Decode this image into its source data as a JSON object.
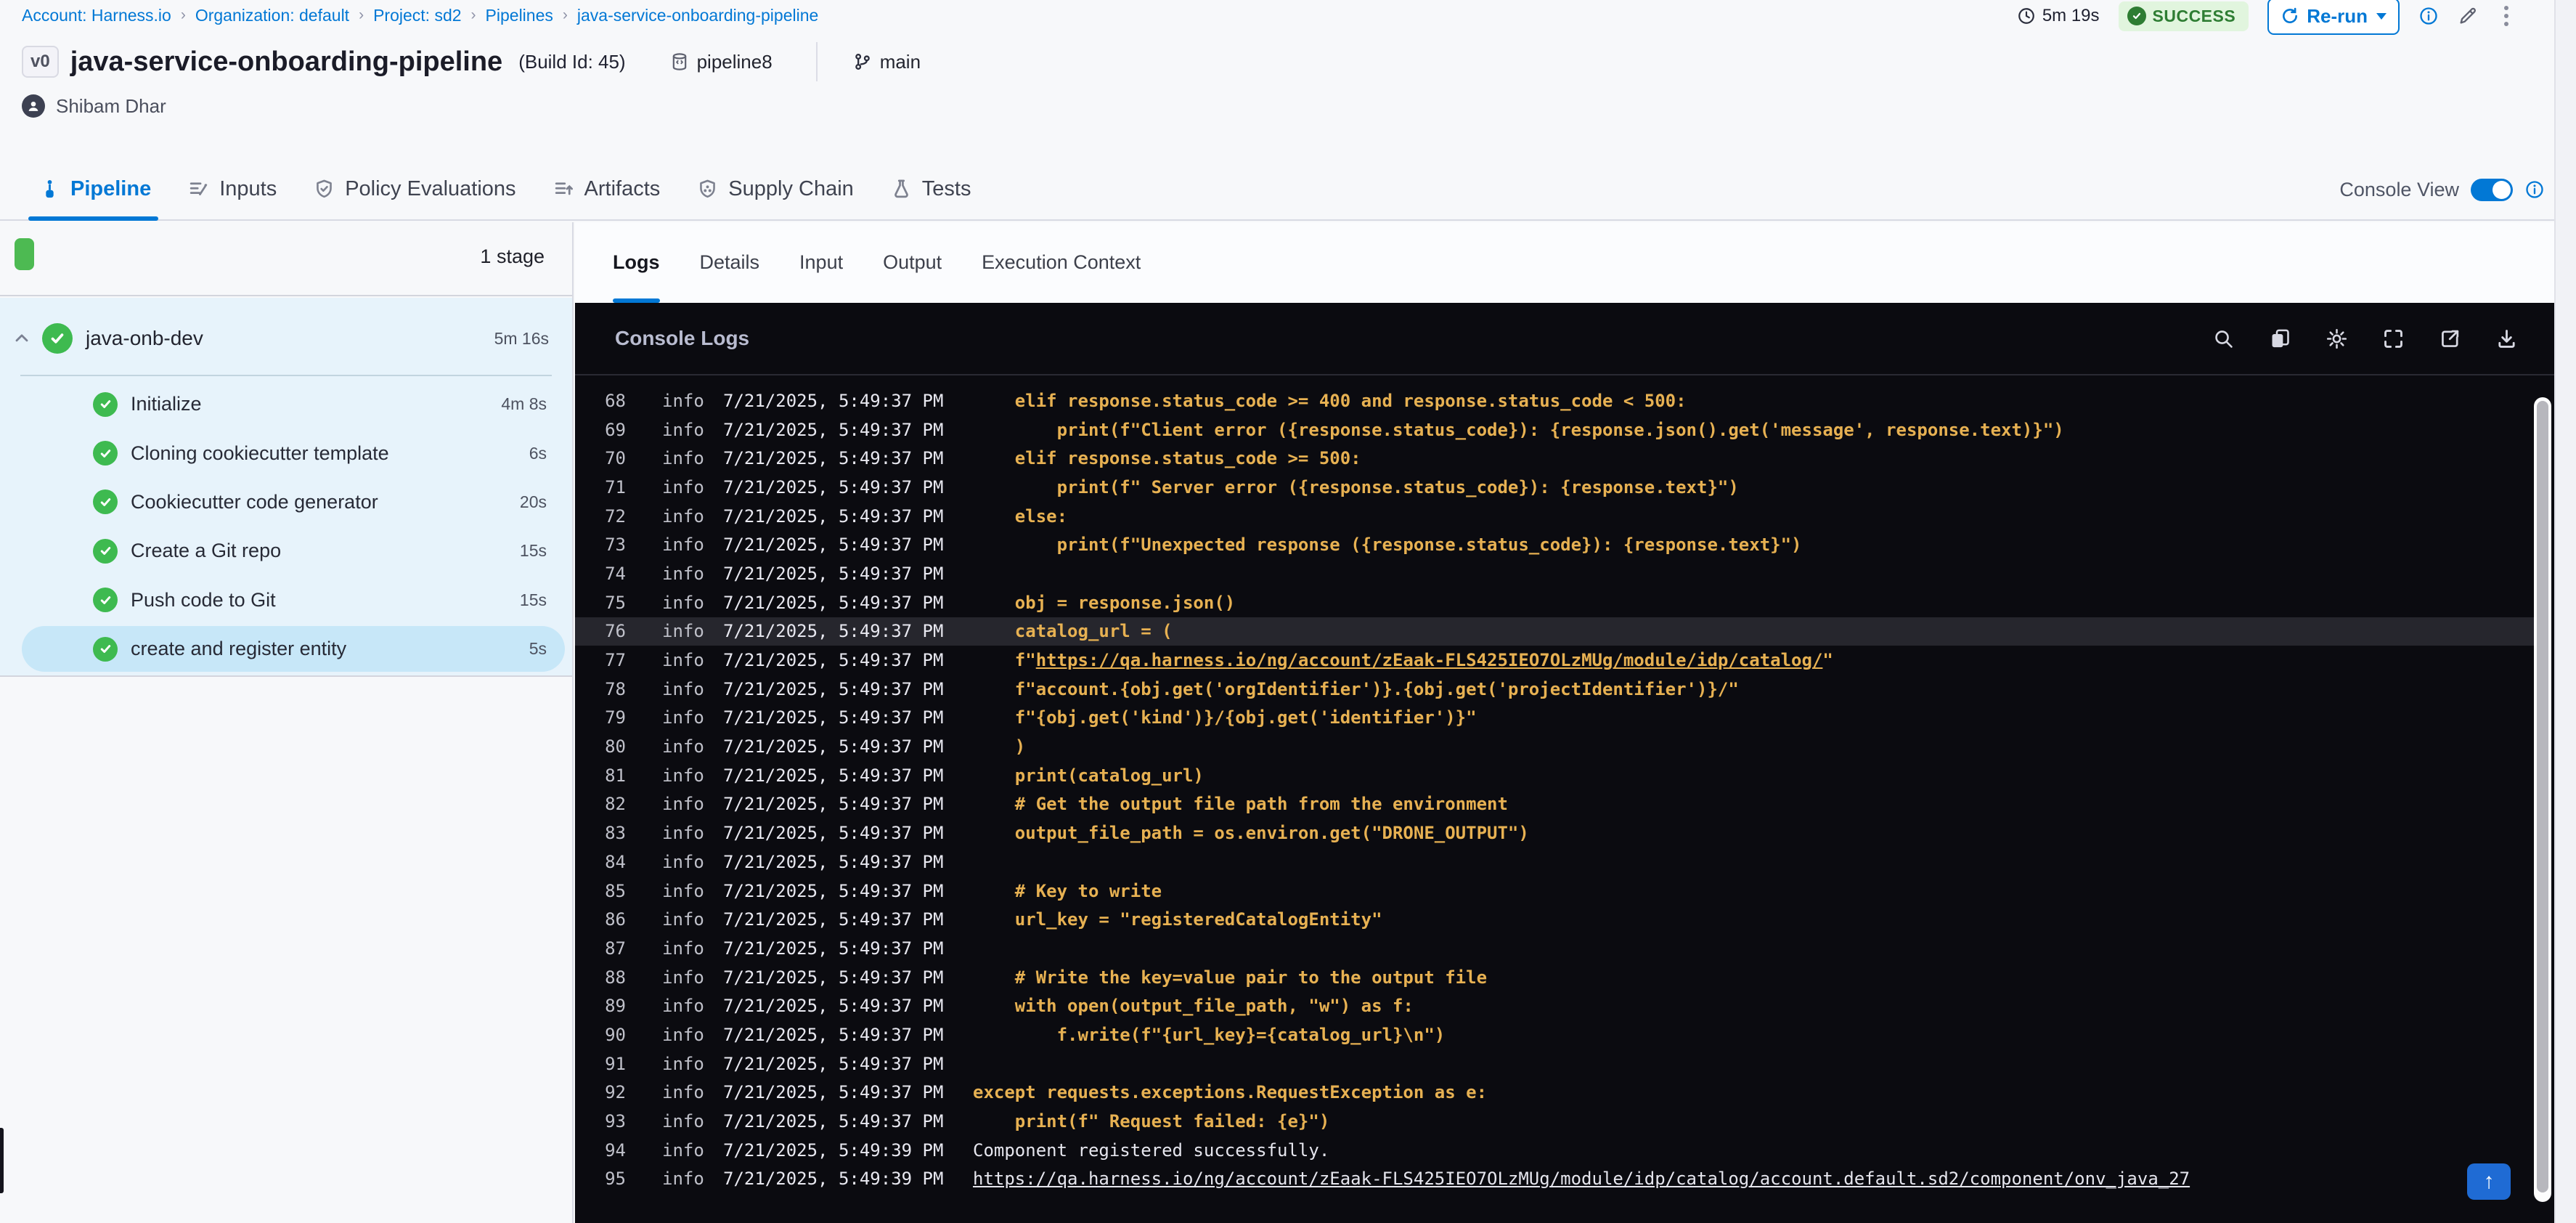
{
  "breadcrumb": {
    "items": [
      {
        "label": "Account: Harness.io"
      },
      {
        "label": "Organization: default"
      },
      {
        "label": "Project: sd2"
      },
      {
        "label": "Pipelines"
      },
      {
        "label": "java-service-onboarding-pipeline"
      }
    ]
  },
  "topbar": {
    "duration": "5m 19s",
    "status": "SUCCESS",
    "rerun_label": "Re-run"
  },
  "header": {
    "version_badge": "v0",
    "title": "java-service-onboarding-pipeline",
    "build_id": "(Build Id: 45)",
    "pipeline_tag": "pipeline8",
    "branch": "main",
    "author": "Shibam Dhar"
  },
  "tabs": {
    "console_view_label": "Console View",
    "items": [
      {
        "label": "Pipeline",
        "icon": "pipeline-icon",
        "active": true
      },
      {
        "label": "Inputs",
        "icon": "inputs-icon",
        "active": false
      },
      {
        "label": "Policy Evaluations",
        "icon": "policy-icon",
        "active": false
      },
      {
        "label": "Artifacts",
        "icon": "artifacts-icon",
        "active": false
      },
      {
        "label": "Supply Chain",
        "icon": "supplychain-icon",
        "active": false
      },
      {
        "label": "Tests",
        "icon": "tests-icon",
        "active": false
      }
    ]
  },
  "sidebar": {
    "stage_count_label": "1 stage",
    "stage": {
      "name": "java-onb-dev",
      "duration": "5m 16s"
    },
    "steps": [
      {
        "label": "Initialize",
        "duration": "4m 8s",
        "selected": false
      },
      {
        "label": "Cloning cookiecutter template",
        "duration": "6s",
        "selected": false
      },
      {
        "label": "Cookiecutter code generator",
        "duration": "20s",
        "selected": false
      },
      {
        "label": "Create a Git repo",
        "duration": "15s",
        "selected": false
      },
      {
        "label": "Push code to Git",
        "duration": "15s",
        "selected": false
      },
      {
        "label": "create and register entity",
        "duration": "5s",
        "selected": true
      }
    ]
  },
  "panel": {
    "tabs": [
      {
        "label": "Logs",
        "active": true
      },
      {
        "label": "Details",
        "active": false
      },
      {
        "label": "Input",
        "active": false
      },
      {
        "label": "Output",
        "active": false
      },
      {
        "label": "Execution Context",
        "active": false
      }
    ]
  },
  "console": {
    "title": "Console Logs",
    "icons": [
      {
        "name": "search-icon"
      },
      {
        "name": "copy-icon"
      },
      {
        "name": "gear-icon"
      },
      {
        "name": "fullscreen-icon"
      },
      {
        "name": "open-in-new-icon"
      },
      {
        "name": "download-icon"
      }
    ],
    "scroll_top_icon": "arrow-up-icon",
    "lines": [
      {
        "n": 68,
        "lvl": "info",
        "ts": "7/21/2025, 5:49:37 PM",
        "seg": [
          {
            "t": "    elif response.status_code >= 400 and response.status_code < 500:"
          }
        ]
      },
      {
        "n": 69,
        "lvl": "info",
        "ts": "7/21/2025, 5:49:37 PM",
        "seg": [
          {
            "t": "        print(f\"Client error ({response.status_code}): {response.json().get('message', response.text)}\")"
          }
        ]
      },
      {
        "n": 70,
        "lvl": "info",
        "ts": "7/21/2025, 5:49:37 PM",
        "seg": [
          {
            "t": "    elif response.status_code >= 500:"
          }
        ]
      },
      {
        "n": 71,
        "lvl": "info",
        "ts": "7/21/2025, 5:49:37 PM",
        "seg": [
          {
            "t": "        print(f\" Server error ({response.status_code}): {response.text}\")"
          }
        ]
      },
      {
        "n": 72,
        "lvl": "info",
        "ts": "7/21/2025, 5:49:37 PM",
        "seg": [
          {
            "t": "    else:"
          }
        ]
      },
      {
        "n": 73,
        "lvl": "info",
        "ts": "7/21/2025, 5:49:37 PM",
        "seg": [
          {
            "t": "        print(f\"Unexpected response ({response.status_code}): {response.text}\")"
          }
        ]
      },
      {
        "n": 74,
        "lvl": "info",
        "ts": "7/21/2025, 5:49:37 PM",
        "seg": []
      },
      {
        "n": 75,
        "lvl": "info",
        "ts": "7/21/2025, 5:49:37 PM",
        "seg": [
          {
            "t": "    obj = response.json()"
          }
        ]
      },
      {
        "n": 76,
        "lvl": "info",
        "ts": "7/21/2025, 5:49:37 PM",
        "highlight": true,
        "seg": [
          {
            "t": "    catalog_url = ("
          }
        ]
      },
      {
        "n": 77,
        "lvl": "info",
        "ts": "7/21/2025, 5:49:37 PM",
        "seg": [
          {
            "t": "    f\""
          },
          {
            "t": "https://qa.harness.io/ng/account/zEaak-FLS425IEO7OLzMUg/module/idp/catalog/",
            "u": true
          },
          {
            "t": "\""
          }
        ]
      },
      {
        "n": 78,
        "lvl": "info",
        "ts": "7/21/2025, 5:49:37 PM",
        "seg": [
          {
            "t": "    f\"account.{obj.get('orgIdentifier')}.{obj.get('projectIdentifier')}/\""
          }
        ]
      },
      {
        "n": 79,
        "lvl": "info",
        "ts": "7/21/2025, 5:49:37 PM",
        "seg": [
          {
            "t": "    f\"{obj.get('kind')}/{obj.get('identifier')}\""
          }
        ]
      },
      {
        "n": 80,
        "lvl": "info",
        "ts": "7/21/2025, 5:49:37 PM",
        "seg": [
          {
            "t": "    )"
          }
        ]
      },
      {
        "n": 81,
        "lvl": "info",
        "ts": "7/21/2025, 5:49:37 PM",
        "seg": [
          {
            "t": "    print(catalog_url)"
          }
        ]
      },
      {
        "n": 82,
        "lvl": "info",
        "ts": "7/21/2025, 5:49:37 PM",
        "seg": [
          {
            "t": "    # Get the output file path from the environment"
          }
        ]
      },
      {
        "n": 83,
        "lvl": "info",
        "ts": "7/21/2025, 5:49:37 PM",
        "seg": [
          {
            "t": "    output_file_path = os.environ.get(\"DRONE_OUTPUT\")"
          }
        ]
      },
      {
        "n": 84,
        "lvl": "info",
        "ts": "7/21/2025, 5:49:37 PM",
        "seg": []
      },
      {
        "n": 85,
        "lvl": "info",
        "ts": "7/21/2025, 5:49:37 PM",
        "seg": [
          {
            "t": "    # Key to write"
          }
        ]
      },
      {
        "n": 86,
        "lvl": "info",
        "ts": "7/21/2025, 5:49:37 PM",
        "seg": [
          {
            "t": "    url_key = \"registeredCatalogEntity\""
          }
        ]
      },
      {
        "n": 87,
        "lvl": "info",
        "ts": "7/21/2025, 5:49:37 PM",
        "seg": []
      },
      {
        "n": 88,
        "lvl": "info",
        "ts": "7/21/2025, 5:49:37 PM",
        "seg": [
          {
            "t": "    # Write the key=value pair to the output file"
          }
        ]
      },
      {
        "n": 89,
        "lvl": "info",
        "ts": "7/21/2025, 5:49:37 PM",
        "seg": [
          {
            "t": "    with open(output_file_path, \"w\") as f:"
          }
        ]
      },
      {
        "n": 90,
        "lvl": "info",
        "ts": "7/21/2025, 5:49:37 PM",
        "seg": [
          {
            "t": "        f.write(f\"{url_key}={catalog_url}\\n\")"
          }
        ]
      },
      {
        "n": 91,
        "lvl": "info",
        "ts": "7/21/2025, 5:49:37 PM",
        "seg": []
      },
      {
        "n": 92,
        "lvl": "info",
        "ts": "7/21/2025, 5:49:37 PM",
        "seg": [
          {
            "t": "except requests.exceptions.RequestException as e:"
          }
        ]
      },
      {
        "n": 93,
        "lvl": "info",
        "ts": "7/21/2025, 5:49:37 PM",
        "seg": [
          {
            "t": "    print(f\" Request failed: {e}\")"
          }
        ]
      },
      {
        "n": 94,
        "lvl": "info",
        "ts": "7/21/2025, 5:49:39 PM",
        "seg": [
          {
            "t": "Component registered successfully.",
            "c": "w"
          }
        ]
      },
      {
        "n": 95,
        "lvl": "info",
        "ts": "7/21/2025, 5:49:39 PM",
        "seg": [
          {
            "t": "https://qa.harness.io/ng/account/zEaak-FLS425IEO7OLzMUg/module/idp/catalog/account.default.sd2/component/onv_java_27",
            "c": "w",
            "u": true
          }
        ]
      }
    ]
  }
}
